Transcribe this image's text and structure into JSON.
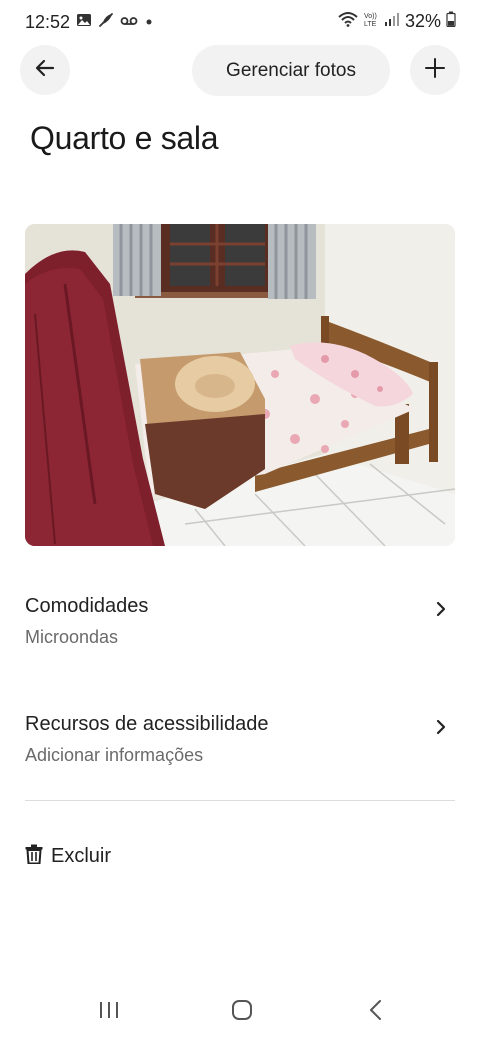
{
  "status_bar": {
    "time": "12:52",
    "left_icons": [
      "gallery-icon",
      "feather-icon",
      "voicemail-icon",
      "dot-icon"
    ],
    "right_icons": [
      "wifi-icon",
      "volte-icon",
      "signal-icon",
      "battery-icon"
    ],
    "battery": "32%"
  },
  "header": {
    "back_icon": "arrow-left-icon",
    "manage_photos_label": "Gerenciar fotos",
    "add_icon": "plus-icon"
  },
  "page": {
    "title": "Quarto e sala"
  },
  "photo": {
    "subject": "bedroom"
  },
  "sections": [
    {
      "title": "Comodidades",
      "subtitle": "Microondas",
      "icon": "chevron-right-icon"
    },
    {
      "title": "Recursos de acessibilidade",
      "subtitle": "Adicionar informações",
      "icon": "chevron-right-icon"
    }
  ],
  "delete": {
    "icon": "trash-icon",
    "label": "Excluir"
  },
  "nav_bar": {
    "items": [
      "recent-apps-icon",
      "home-icon",
      "back-icon"
    ]
  }
}
